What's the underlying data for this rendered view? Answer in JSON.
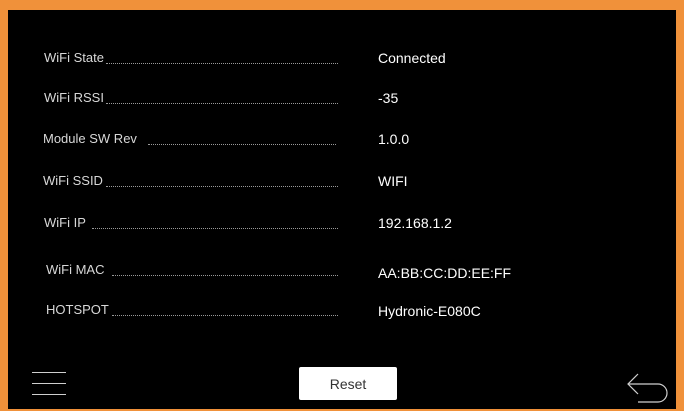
{
  "info_rows": [
    {
      "label": "WiFi State",
      "value": "Connected"
    },
    {
      "label": "WiFi RSSI",
      "value": "-35"
    },
    {
      "label": "Module SW Rev",
      "value": "1.0.0"
    },
    {
      "label": "WiFi SSID",
      "value": "WIFI"
    },
    {
      "label": "WiFi IP",
      "value": "192.168.1.2"
    },
    {
      "label": "WiFi MAC",
      "value": "AA:BB:CC:DD:EE:FF"
    },
    {
      "label": "HOTSPOT",
      "value": "Hydronic-E080C"
    }
  ],
  "footer": {
    "reset_label": "Reset",
    "menu_icon": "hamburger-menu-icon",
    "back_icon": "back-arrow-icon"
  },
  "colors": {
    "frame": "#f0913a",
    "background": "#000000",
    "label_text": "#d8d8d8",
    "value_text": "#ffffff",
    "button_bg": "#ffffff"
  }
}
